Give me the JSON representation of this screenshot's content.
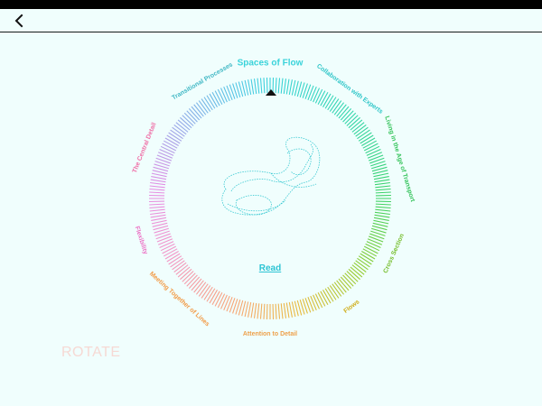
{
  "nav": {
    "back_icon": "chevron-left-icon"
  },
  "wheel": {
    "selected": "Spaces of Flow",
    "sections": [
      {
        "label": "Spaces of Flow",
        "color": "#3ad3da",
        "angle": 0
      },
      {
        "label": "Collaboration with Experts",
        "color": "#2fc6c8",
        "angle": 36
      },
      {
        "label": "Living in the Age of Transport",
        "color": "#33c35a",
        "angle": 73
      },
      {
        "label": "Cross Section",
        "color": "#76be2d",
        "angle": 114
      },
      {
        "label": "Flows",
        "color": "#d0ae1c",
        "angle": 143
      },
      {
        "label": "Attention to Detail",
        "color": "#eea14c",
        "angle": 180
      },
      {
        "label": "Meeting Together of Lines",
        "color": "#f29a45",
        "angle": 222
      },
      {
        "label": "Flexibility",
        "color": "#ec6fc4",
        "angle": 252
      },
      {
        "label": "The Central Detail",
        "color": "#ef6ea6",
        "angle": 292
      },
      {
        "label": "Transitional Processes",
        "color": "#3fb7c4",
        "angle": 330
      }
    ]
  },
  "read_label": "Read",
  "rotate_label": "ROTATE"
}
